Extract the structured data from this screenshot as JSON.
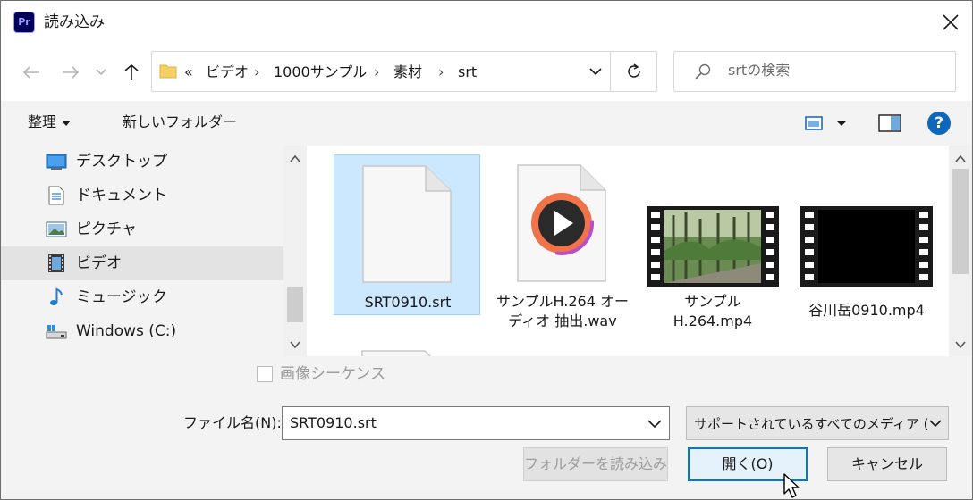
{
  "window": {
    "app_icon_text": "Pr",
    "title": "読み込み"
  },
  "address_bar": {
    "overflow": "«",
    "breadcrumbs": [
      "ビデオ",
      "1000サンプル",
      "素材",
      "srt"
    ],
    "separator": "›"
  },
  "search": {
    "placeholder": "srtの検索"
  },
  "toolbar": {
    "organize_label": "整理",
    "new_folder_label": "新しいフォルダー",
    "help_label": "?"
  },
  "nav_pane": {
    "items": [
      {
        "label": "デスクトップ",
        "icon": "desktop-icon"
      },
      {
        "label": "ドキュメント",
        "icon": "documents-icon"
      },
      {
        "label": "ピクチャ",
        "icon": "pictures-icon"
      },
      {
        "label": "ビデオ",
        "icon": "videos-icon",
        "selected": true
      },
      {
        "label": "ミュージック",
        "icon": "music-icon"
      },
      {
        "label": "Windows (C:)",
        "icon": "drive-icon"
      }
    ]
  },
  "files": [
    {
      "name": "SRT0910.srt",
      "type": "document",
      "selected": true
    },
    {
      "name": "サンプルH.264 オーディオ 抽出.wav",
      "lines": [
        "サンプルH.264 オー",
        "ディオ 抽出.wav"
      ],
      "type": "audio"
    },
    {
      "name": "サンプル H.264.mp4",
      "lines": [
        "サンプル",
        "H.264.mp4"
      ],
      "type": "video-forest"
    },
    {
      "name": "谷川岳0910.mp4",
      "lines": [
        "谷川岳0910.mp4"
      ],
      "type": "video-black"
    }
  ],
  "bottom": {
    "image_sequence_label": "画像シーケンス",
    "image_sequence_checked": false,
    "file_name_label": "ファイル名(N):",
    "file_name_value": "SRT0910.srt",
    "file_type_value": "サポートされているすべてのメディア (*",
    "import_folder_label": "フォルダーを読み込み",
    "open_label": "開く(O)",
    "cancel_label": "キャンセル"
  },
  "colors": {
    "accent": "#0078d7",
    "selection_bg": "#cce8ff",
    "help_blue": "#1066b8",
    "premiere_bg": "#00005b",
    "premiere_fg": "#9999ff"
  }
}
